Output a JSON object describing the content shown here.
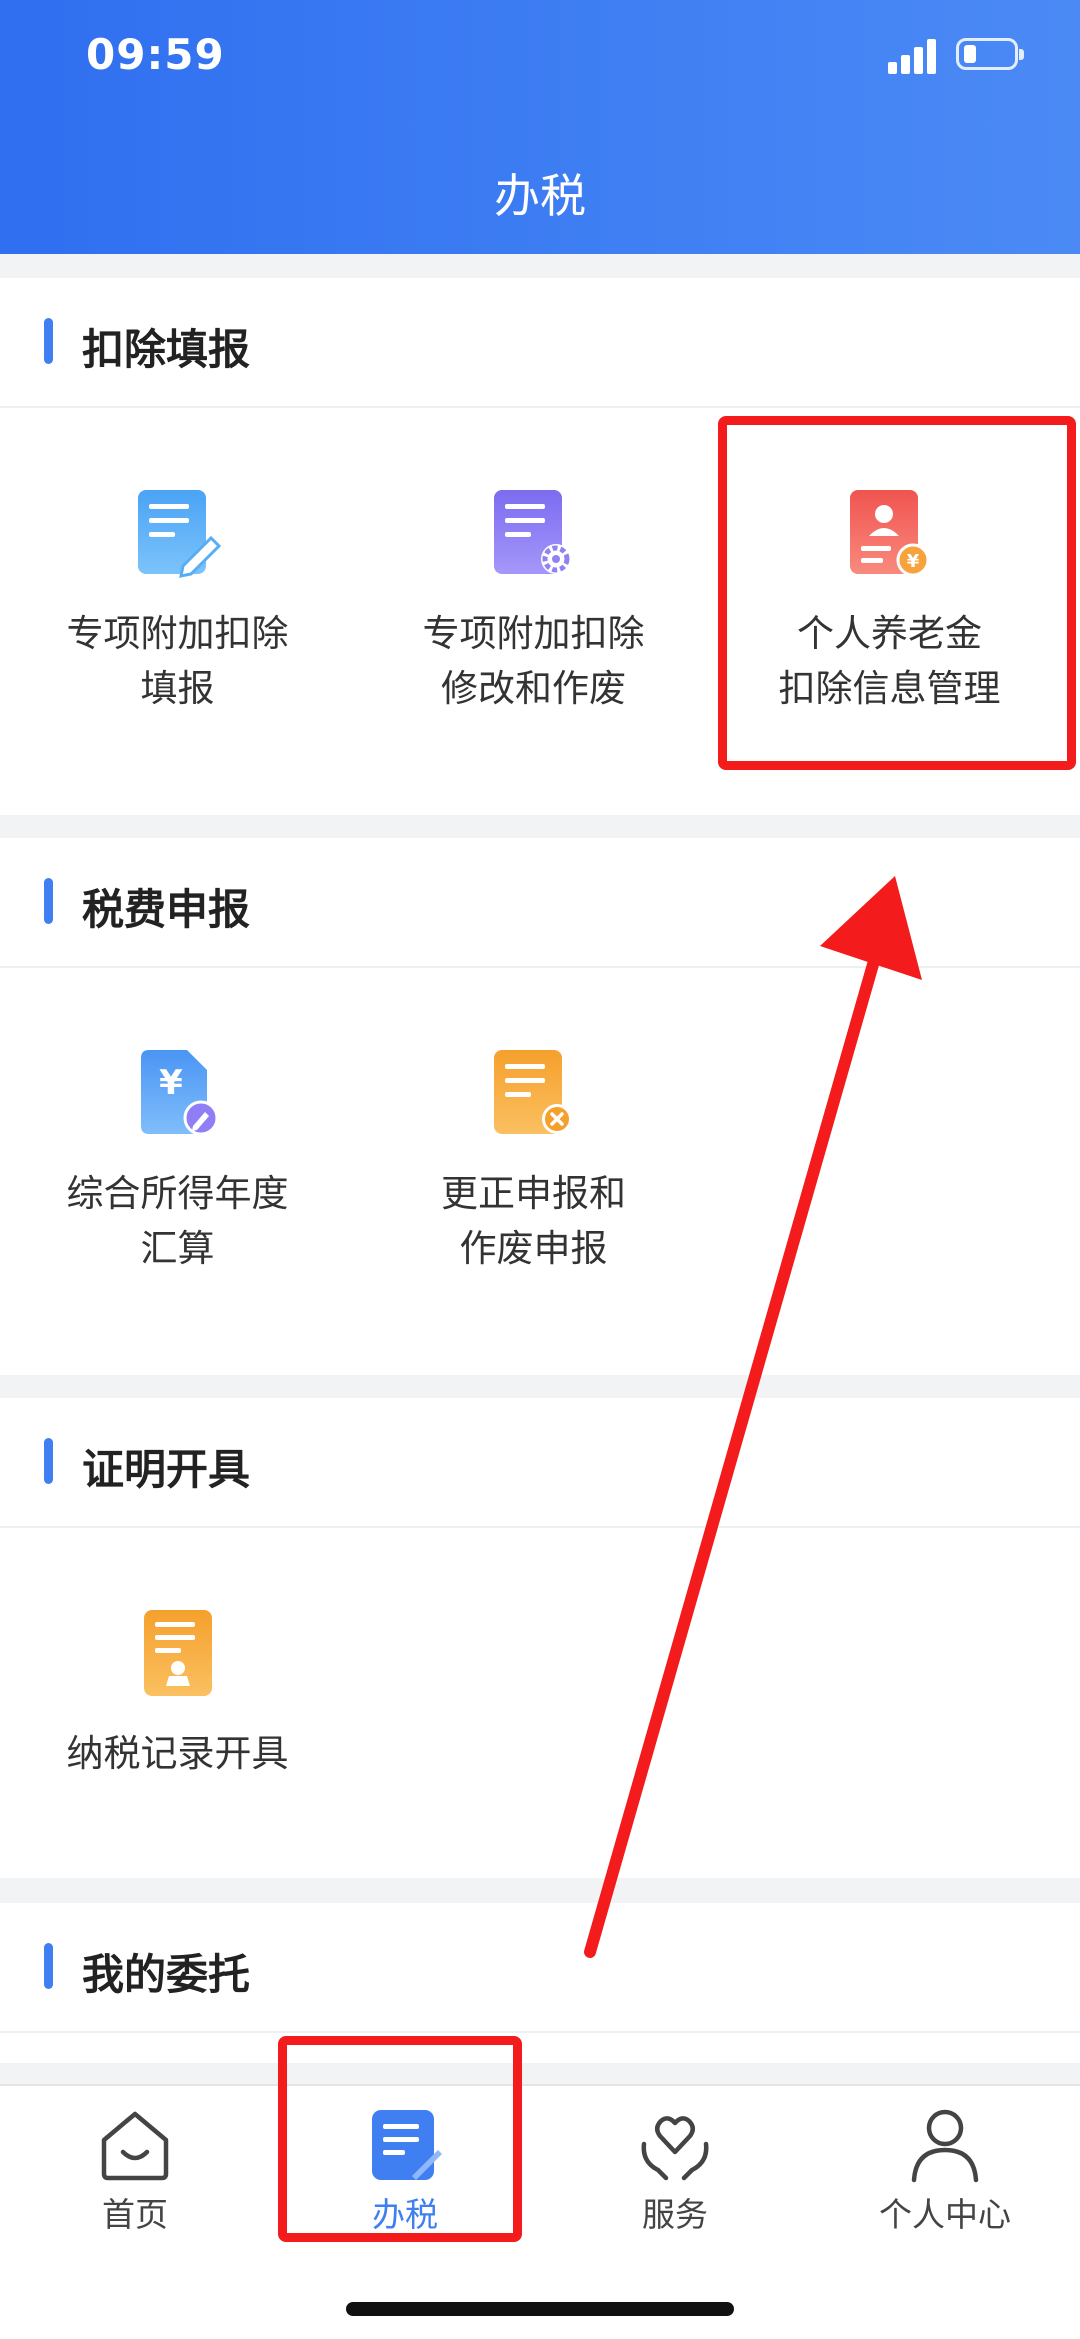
{
  "status_bar": {
    "time": "09:59"
  },
  "header": {
    "title": "办税"
  },
  "sections": [
    {
      "title": "扣除填报",
      "tiles": [
        {
          "line1": "专项附加扣除",
          "line2": "填报",
          "icon": "doc-edit-icon"
        },
        {
          "line1": "专项附加扣除",
          "line2": "修改和作废",
          "icon": "doc-gear-icon"
        },
        {
          "line1": "个人养老金",
          "line2": "扣除信息管理",
          "icon": "pension-doc-icon"
        }
      ]
    },
    {
      "title": "税费申报",
      "tiles": [
        {
          "line1": "综合所得年度",
          "line2": "汇算",
          "icon": "yuan-doc-edit-icon"
        },
        {
          "line1": "更正申报和",
          "line2": "作废申报",
          "icon": "doc-cancel-icon"
        }
      ]
    },
    {
      "title": "证明开具",
      "tiles": [
        {
          "line1": "纳税记录开具",
          "icon": "certificate-icon"
        }
      ]
    },
    {
      "title": "我的委托",
      "tiles": []
    }
  ],
  "tabbar": {
    "items": [
      {
        "label": "首页",
        "icon": "home-icon",
        "active": false
      },
      {
        "label": "办税",
        "icon": "tax-doc-icon",
        "active": true
      },
      {
        "label": "服务",
        "icon": "heart-hands-icon",
        "active": false
      },
      {
        "label": "个人中心",
        "icon": "person-icon",
        "active": false
      }
    ]
  },
  "colors": {
    "primary": "#3f7ff2",
    "highlight": "#f31b1b"
  }
}
